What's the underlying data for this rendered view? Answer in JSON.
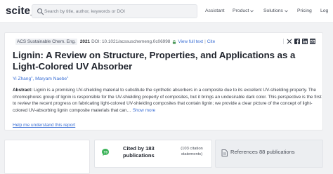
{
  "header": {
    "logo": "scite_",
    "search_placeholder": "Search by title, author, keywords or DOI",
    "nav": [
      "Assistant",
      "Product",
      "Solutions",
      "Pricing",
      "Log"
    ]
  },
  "paper": {
    "journal": "ACS Sustainable Chem. Eng.",
    "year": "2021",
    "doi": "DOI: 10.1021/acssuschemeng.0c06998",
    "view_full_text": "View full text",
    "cite": "Cite",
    "separator": "|",
    "title": "Lignin: A Review on Structure, Properties, and Applications as a Light-Colored UV Absorber",
    "authors": [
      {
        "name": "Yi Zhang",
        "sup": "1"
      },
      {
        "name": "Maryam Naebe",
        "sup": "1"
      }
    ],
    "author_separator": ",",
    "abstract_label": "Abstract:",
    "abstract_text": " Lignin is a promising UV-shielding material to substitute the synthetic absorbers in a composite due to its excellent UV-shielding property. The chromophores group of lignin is responsible for the UV-shielding property of composites, but it brings an undesirable dark color. This perspective is the first to review the recent progress on fabricating light-colored UV-shielding composites that contain lignin; we provide a clear picture of the concept of light-colored UV-absorbing lignin composite materials that can… ",
    "show_more": "Show more",
    "help_link": "Help me understand this report"
  },
  "stats": {
    "cited_by": "Cited by 183 publications",
    "citation_statements": "(103 citation statements)",
    "references": "References 88 publications"
  },
  "colors": {
    "link": "#3b6fd4",
    "cite_accent": "#3db35a",
    "background": "#f1f2f4"
  },
  "icons": {
    "search": "search-icon",
    "lock": "lock-icon",
    "share": [
      "x-icon",
      "facebook-icon",
      "linkedin-icon",
      "email-icon"
    ],
    "cited": "quote-bubble-icon",
    "references": "document-icon"
  }
}
